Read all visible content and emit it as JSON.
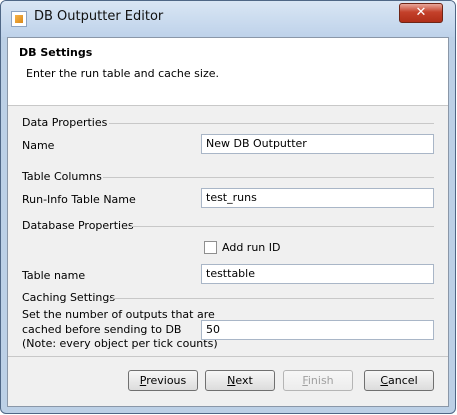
{
  "window": {
    "title": "DB Outputter Editor",
    "close_glyph": "✕"
  },
  "header": {
    "title": "DB Settings",
    "description": "Enter the run table and cache size."
  },
  "sections": {
    "data_properties": "Data Properties",
    "table_columns": "Table Columns",
    "database_properties": "Database Properties",
    "caching_settings": "Caching Settings"
  },
  "fields": {
    "name": {
      "label": "Name",
      "value": "New DB Outputter"
    },
    "run_info_table": {
      "label": "Run-Info Table Name",
      "value": "test_runs"
    },
    "add_run_id": {
      "label": "Add run ID",
      "checked": false
    },
    "table_name": {
      "label": "Table name",
      "value": "testtable"
    },
    "cache_size": {
      "label_line1": "Set the number of outputs that are",
      "label_line2": "cached before sending to DB",
      "label_line3": "(Note: every object per tick counts)",
      "value": "50"
    }
  },
  "buttons": {
    "previous": {
      "mnemonic": "P",
      "rest": "revious",
      "enabled": true
    },
    "next": {
      "mnemonic": "N",
      "rest": "ext",
      "enabled": true
    },
    "finish": {
      "mnemonic": "F",
      "rest": "inish",
      "enabled": false
    },
    "cancel": {
      "mnemonic": "C",
      "rest": "ancel",
      "enabled": true
    }
  }
}
